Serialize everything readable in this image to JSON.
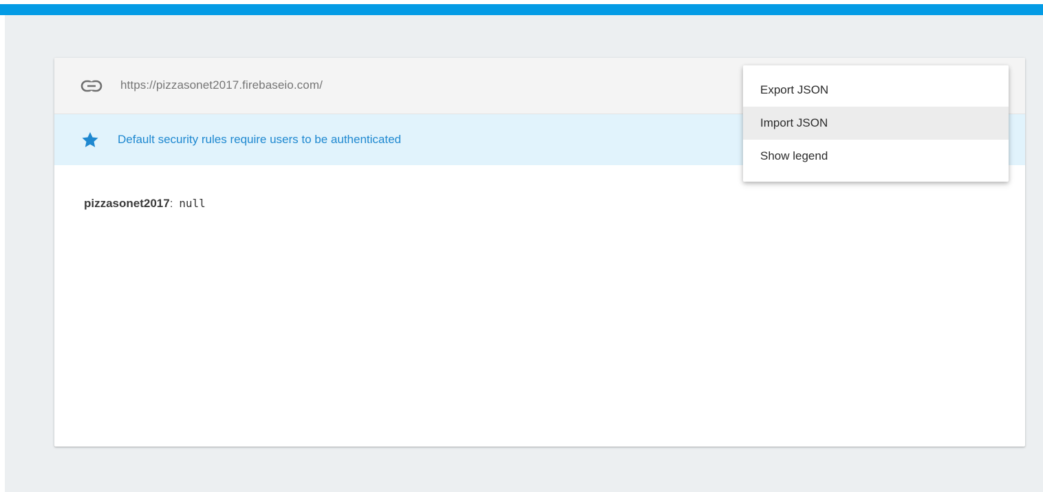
{
  "database": {
    "url": "https://pizzasonet2017.firebaseio.com/"
  },
  "banner": {
    "icon": "star-icon",
    "text": "Default security rules require users to be authenticated",
    "color": "#1e88d0"
  },
  "tree": {
    "root_key": "pizzasonet2017",
    "separator": ":",
    "root_value": "null"
  },
  "menu": {
    "items": [
      {
        "label": "Export JSON"
      },
      {
        "label": "Import JSON"
      },
      {
        "label": "Show legend"
      }
    ],
    "highlighted": "Import JSON"
  },
  "colors": {
    "accent": "#039be5",
    "page_background": "#eceff1",
    "banner_background": "#e1f3fc"
  }
}
